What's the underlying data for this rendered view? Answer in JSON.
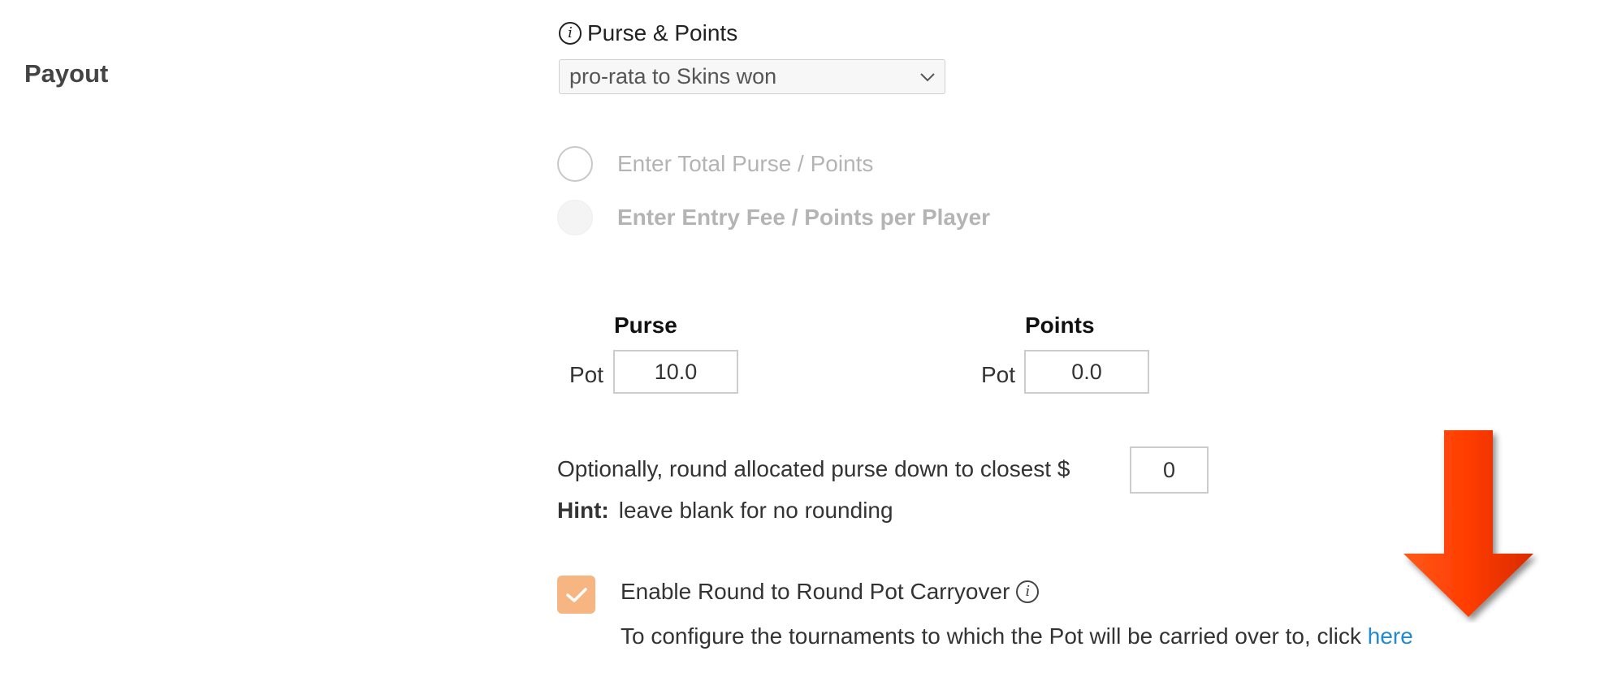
{
  "payout": {
    "label": "Payout"
  },
  "purse_points": {
    "title": "Purse & Points",
    "info_icon": "info-icon",
    "select": {
      "value": "pro-rata to Skins won",
      "icon": "chevron-down-icon"
    }
  },
  "options": {
    "total": "Enter Total Purse / Points",
    "entry_fee": "Enter Entry Fee / Points per Player"
  },
  "pots": {
    "purse": {
      "header": "Purse",
      "label": "Pot",
      "value": "10.0"
    },
    "points": {
      "header": "Points",
      "label": "Pot",
      "value": "0.0"
    }
  },
  "rounding": {
    "text": "Optionally, round allocated purse down to closest $",
    "value": "0",
    "hint_label": "Hint:",
    "hint_text": "leave blank for no rounding"
  },
  "carryover": {
    "checked": true,
    "label": "Enable Round to Round Pot Carryover",
    "config_text": "To configure the tournaments to which the Pot will be carried over to, click",
    "link": "here",
    "check_color": "#f7b681",
    "link_color": "#1f8ad0",
    "arrow_color": "#ff3c00"
  }
}
